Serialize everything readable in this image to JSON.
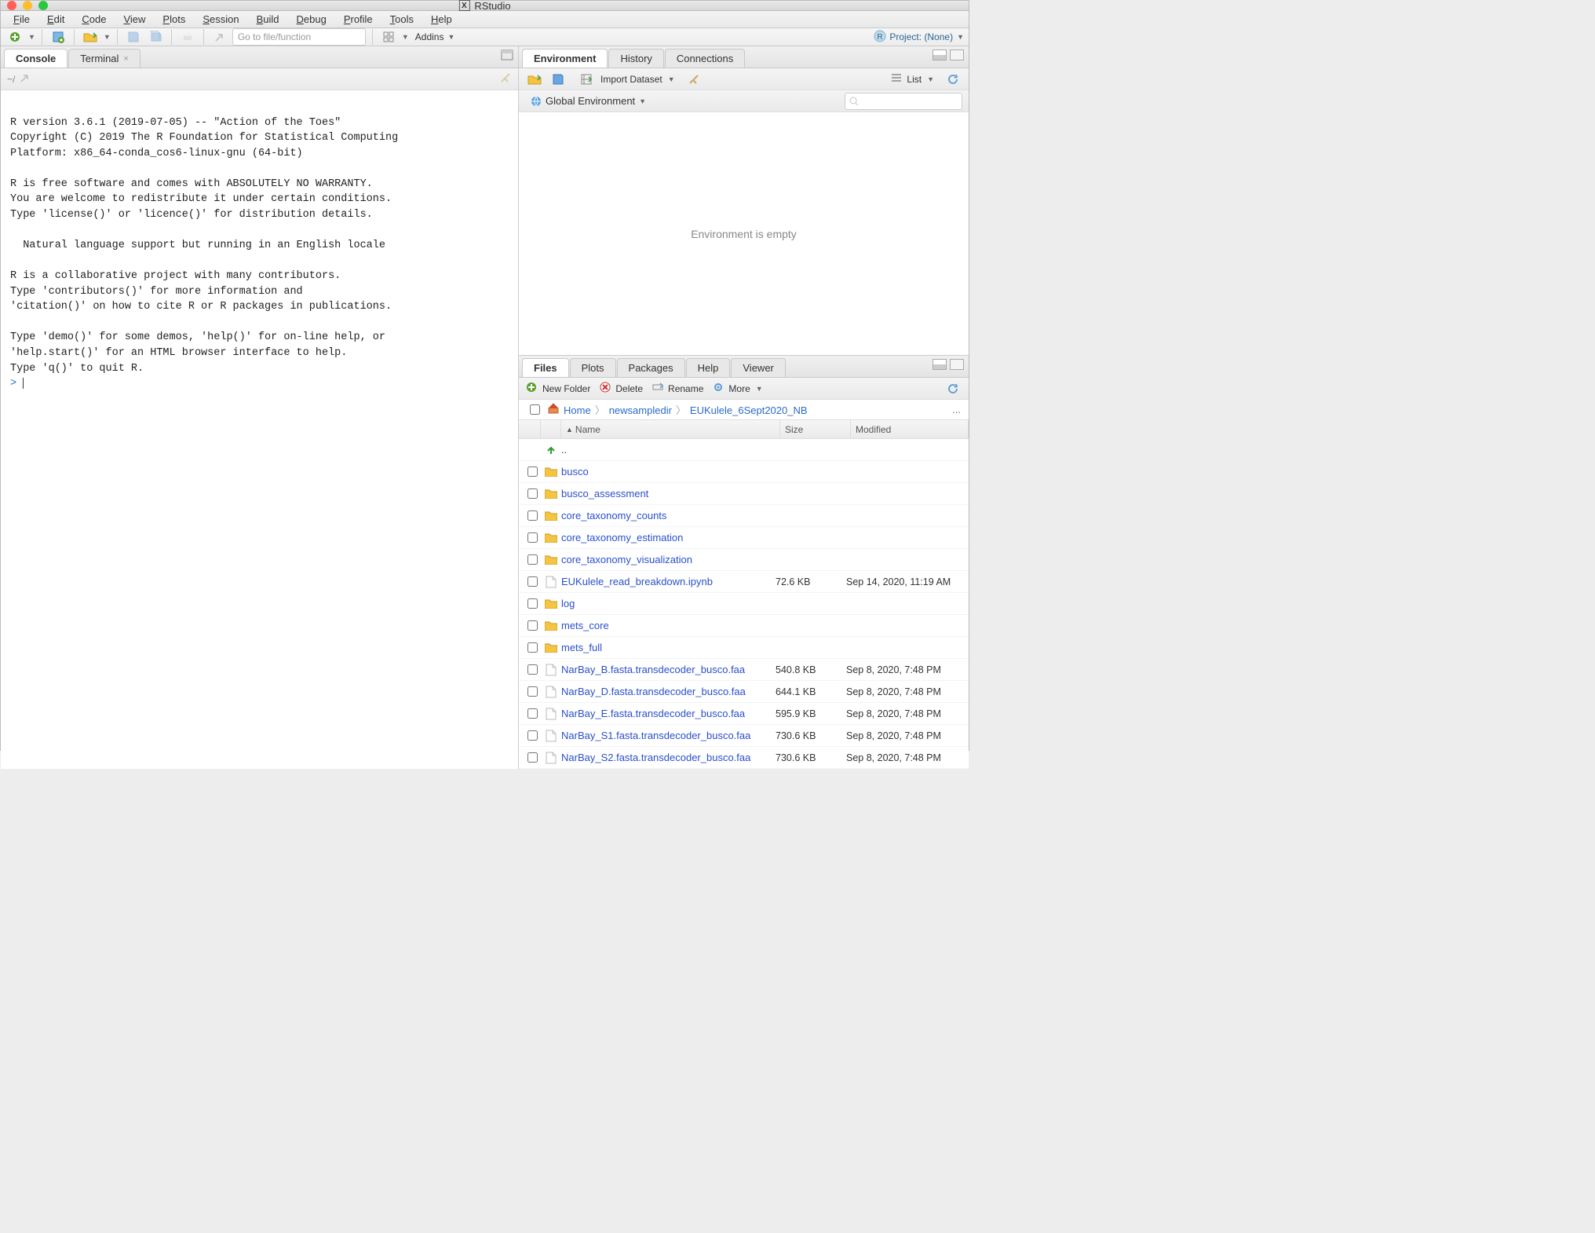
{
  "window": {
    "title": "RStudio"
  },
  "menubar": [
    "File",
    "Edit",
    "Code",
    "View",
    "Plots",
    "Session",
    "Build",
    "Debug",
    "Profile",
    "Tools",
    "Help"
  ],
  "toolbar": {
    "goto_placeholder": "Go to file/function",
    "addins_label": "Addins",
    "project_label": "Project: (None)"
  },
  "left": {
    "tabs": [
      {
        "label": "Console",
        "active": true,
        "closable": false
      },
      {
        "label": "Terminal",
        "active": false,
        "closable": true
      }
    ],
    "console_text": "\nR version 3.6.1 (2019-07-05) -- \"Action of the Toes\"\nCopyright (C) 2019 The R Foundation for Statistical Computing\nPlatform: x86_64-conda_cos6-linux-gnu (64-bit)\n\nR is free software and comes with ABSOLUTELY NO WARRANTY.\nYou are welcome to redistribute it under certain conditions.\nType 'license()' or 'licence()' for distribution details.\n\n  Natural language support but running in an English locale\n\nR is a collaborative project with many contributors.\nType 'contributors()' for more information and\n'citation()' on how to cite R or R packages in publications.\n\nType 'demo()' for some demos, 'help()' for on-line help, or\n'help.start()' for an HTML browser interface to help.\nType 'q()' to quit R.\n",
    "prompt": "> "
  },
  "env": {
    "tabs": [
      {
        "label": "Environment",
        "active": true
      },
      {
        "label": "History",
        "active": false
      },
      {
        "label": "Connections",
        "active": false
      }
    ],
    "import_label": "Import Dataset",
    "list_label": "List",
    "scope_label": "Global Environment",
    "empty_text": "Environment is empty"
  },
  "files": {
    "tabs": [
      {
        "label": "Files",
        "active": true
      },
      {
        "label": "Plots",
        "active": false
      },
      {
        "label": "Packages",
        "active": false
      },
      {
        "label": "Help",
        "active": false
      },
      {
        "label": "Viewer",
        "active": false
      }
    ],
    "buttons": {
      "new_folder": "New Folder",
      "delete": "Delete",
      "rename": "Rename",
      "more": "More"
    },
    "breadcrumb": [
      "Home",
      "newsampledir",
      "EUKulele_6Sept2020_NB"
    ],
    "columns": {
      "name": "Name",
      "size": "Size",
      "modified": "Modified"
    },
    "up_label": "..",
    "rows": [
      {
        "type": "folder",
        "name": "busco",
        "size": "",
        "modified": ""
      },
      {
        "type": "folder",
        "name": "busco_assessment",
        "size": "",
        "modified": ""
      },
      {
        "type": "folder",
        "name": "core_taxonomy_counts",
        "size": "",
        "modified": ""
      },
      {
        "type": "folder",
        "name": "core_taxonomy_estimation",
        "size": "",
        "modified": ""
      },
      {
        "type": "folder",
        "name": "core_taxonomy_visualization",
        "size": "",
        "modified": ""
      },
      {
        "type": "file",
        "name": "EUKulele_read_breakdown.ipynb",
        "size": "72.6 KB",
        "modified": "Sep 14, 2020, 11:19 AM"
      },
      {
        "type": "folder",
        "name": "log",
        "size": "",
        "modified": ""
      },
      {
        "type": "folder",
        "name": "mets_core",
        "size": "",
        "modified": ""
      },
      {
        "type": "folder",
        "name": "mets_full",
        "size": "",
        "modified": ""
      },
      {
        "type": "file",
        "name": "NarBay_B.fasta.transdecoder_busco.faa",
        "size": "540.8 KB",
        "modified": "Sep 8, 2020, 7:48 PM"
      },
      {
        "type": "file",
        "name": "NarBay_D.fasta.transdecoder_busco.faa",
        "size": "644.1 KB",
        "modified": "Sep 8, 2020, 7:48 PM"
      },
      {
        "type": "file",
        "name": "NarBay_E.fasta.transdecoder_busco.faa",
        "size": "595.9 KB",
        "modified": "Sep 8, 2020, 7:48 PM"
      },
      {
        "type": "file",
        "name": "NarBay_S1.fasta.transdecoder_busco.faa",
        "size": "730.6 KB",
        "modified": "Sep 8, 2020, 7:48 PM"
      },
      {
        "type": "file",
        "name": "NarBay_S2.fasta.transdecoder_busco.faa",
        "size": "730.6 KB",
        "modified": "Sep 8, 2020, 7:48 PM"
      }
    ]
  }
}
